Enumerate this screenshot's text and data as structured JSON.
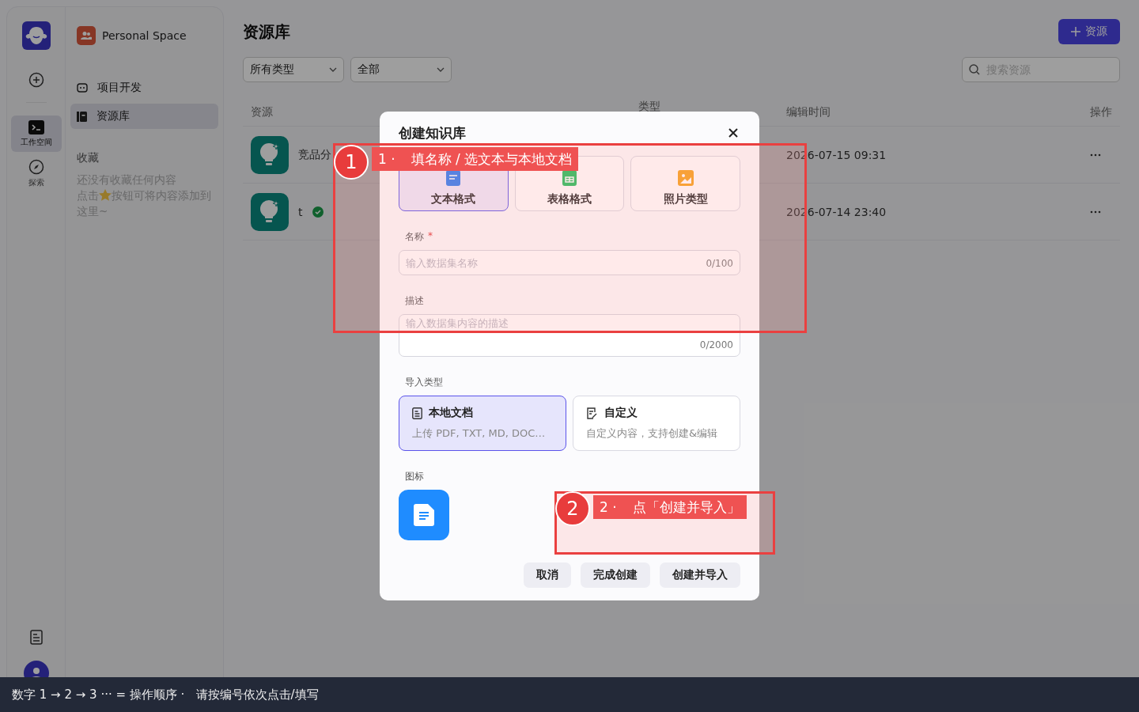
{
  "rail": {
    "items": [
      {
        "label": "工作空间",
        "kind": "terminal",
        "selected": true
      },
      {
        "label": "探索",
        "kind": "compass",
        "selected": false
      }
    ]
  },
  "nav": {
    "space": "Personal Space",
    "items": [
      {
        "label": "项目开发",
        "kind": "bot",
        "selected": false
      },
      {
        "label": "资源库",
        "kind": "book",
        "selected": true
      }
    ],
    "favorites": {
      "title": "收藏",
      "line_1": "还没有收藏任何内容",
      "before_star": "点击",
      "after_star": "按钮可将内容添加到",
      "line_3": "这里~"
    }
  },
  "page": {
    "title": "资源库",
    "add_button": "资源",
    "filters": [
      "所有类型",
      "全部"
    ],
    "search": {
      "placeholder": "搜索资源"
    },
    "table": {
      "columns": [
        "资源",
        "类型",
        "编辑时间",
        "操作"
      ],
      "rows": [
        {
          "name": "竞品分",
          "verified": false,
          "time": "2026-07-15 09:31"
        },
        {
          "name": "t",
          "verified": true,
          "time": "2026-07-14 23:40"
        }
      ]
    }
  },
  "dialog": {
    "title": "创建知识库",
    "formats": [
      {
        "label": "文本格式",
        "kind": "text",
        "selected": true
      },
      {
        "label": "表格格式",
        "kind": "table",
        "selected": false
      },
      {
        "label": "照片类型",
        "kind": "photo",
        "selected": false
      }
    ],
    "name": {
      "label": "名称",
      "required_mark": "*",
      "placeholder": "输入数据集名称",
      "counter": "0/100"
    },
    "description": {
      "label": "描述",
      "placeholder": "输入数据集内容的描述",
      "counter": "0/2000"
    },
    "import": {
      "label": "导入类型",
      "options": [
        {
          "title": "本地文档",
          "desc": "上传 PDF, TXT, MD, DOC…",
          "kind": "file",
          "selected": true
        },
        {
          "title": "自定义",
          "desc": "自定义内容，支持创建&编辑",
          "kind": "edit",
          "selected": false
        }
      ]
    },
    "icon_label": "图标",
    "buttons": [
      "取消",
      "完成创建",
      "创建并导入"
    ]
  },
  "annotations": [
    {
      "number": "1",
      "step": "1 ·",
      "text": "填名称 / 选文本与本地文档"
    },
    {
      "number": "2",
      "step": "2 ·",
      "text": "点「创建并导入」"
    }
  ],
  "hint_bar": "数字 1 → 2 → 3 ··· = 操作顺序 ·   请按编号依次点击/填写"
}
